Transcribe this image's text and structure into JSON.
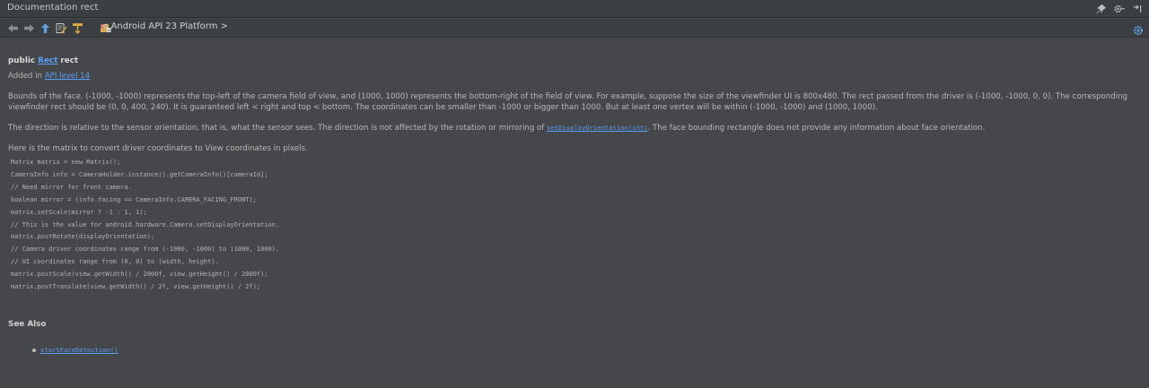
{
  "window": {
    "title": "Documentation rect",
    "title_icons": [
      "pin-icon",
      "gear-icon",
      "minimize-icon"
    ]
  },
  "toolbar": {
    "icons": [
      "back-icon",
      "forward-icon",
      "up-icon",
      "edit-source-icon",
      "external-doc-icon",
      "library-icon"
    ],
    "breadcrumb": "< Android API 23 Platform >"
  },
  "doc": {
    "sig_prefix": "public ",
    "sig_type": "Rect",
    "sig_name": " rect",
    "added_prefix": "Added in ",
    "added_link": "API level 14",
    "para1": "Bounds of the face. (-1000, -1000) represents the top-left of the camera field of view, and (1000, 1000) represents the bottom-right of the field of view. For example, suppose the size of the viewfinder UI is 800x480. The rect passed from the driver is (-1000, -1000, 0, 0). The corresponding viewfinder rect should be (0, 0, 400, 240). It is guaranteed left < right and top < bottom. The coordinates can be smaller than -1000 or bigger than 1000. But at least one vertex will be within (-1000, -1000) and (1000, 1000).",
    "para2_before": "The direction is relative to the sensor orientation, that is, what the sensor sees. The direction is not affected by the rotation or mirroring of ",
    "para2_link": "setDisplayOrientation(int)",
    "para2_after": ". The face bounding rectangle does not provide any information about face orientation.",
    "para3": "Here is the matrix to convert driver coordinates to View coordinates in pixels.",
    "code": "Matrix matrix = new Matrix();\nCameraInfo info = CameraHolder.instance().getCameraInfo()[cameraId];\n// Need mirror for front camera.\nboolean mirror = (info.facing == CameraInfo.CAMERA_FACING_FRONT);\nmatrix.setScale(mirror ? -1 : 1, 1);\n// This is the value for android.hardware.Camera.setDisplayOrientation.\nmatrix.postRotate(displayOrientation);\n// Camera driver coordinates range from (-1000, -1000) to (1000, 1000).\n// UI coordinates range from (0, 0) to (width, height).\nmatrix.postScale(view.getWidth() / 2000f, view.getHeight() / 2000f);\nmatrix.postTranslate(view.getWidth() / 2f, view.getHeight() / 2f);",
    "see_also": "See Also",
    "see_also_items": [
      "startFaceDetection()"
    ]
  },
  "colors": {
    "background": "#45474a",
    "panel": "#3c3f41",
    "link": "#589df6"
  }
}
